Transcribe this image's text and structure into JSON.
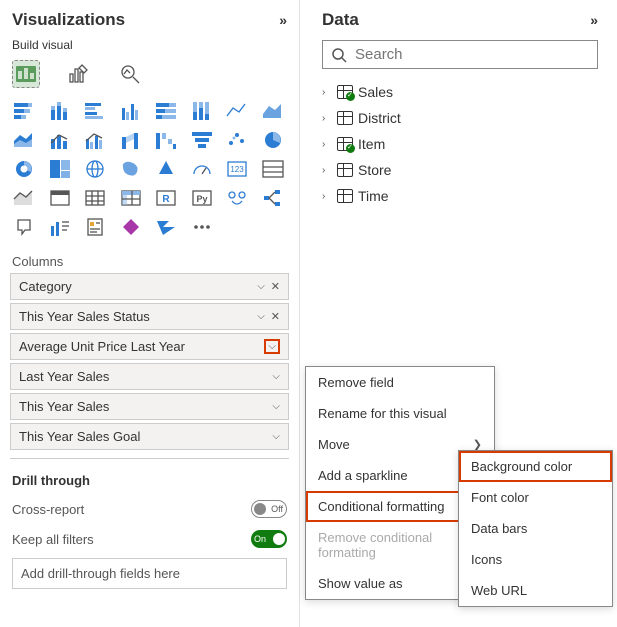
{
  "viz": {
    "title": "Visualizations",
    "subheader": "Build visual",
    "sections": {
      "columns": "Columns",
      "drill": "Drill through"
    },
    "fields": [
      {
        "label": "Category",
        "show_x": true
      },
      {
        "label": "This Year Sales Status",
        "show_x": true
      },
      {
        "label": "Average Unit Price Last Year",
        "show_x": false,
        "chev_highlight": true
      },
      {
        "label": "Last Year Sales",
        "show_x": false
      },
      {
        "label": "This Year Sales",
        "show_x": false
      },
      {
        "label": "This Year Sales Goal",
        "show_x": false
      }
    ],
    "drill": {
      "cross_label": "Cross-report",
      "cross_lbl": "Off",
      "keep_label": "Keep all filters",
      "keep_lbl": "On",
      "placeholder": "Add drill-through fields here"
    }
  },
  "data": {
    "title": "Data",
    "search_placeholder": "Search",
    "tables": [
      {
        "name": "Sales",
        "checked": true
      },
      {
        "name": "District",
        "checked": false
      },
      {
        "name": "Item",
        "checked": true
      },
      {
        "name": "Store",
        "checked": false
      },
      {
        "name": "Time",
        "checked": false
      }
    ]
  },
  "menu1": {
    "items": [
      {
        "label": "Remove field"
      },
      {
        "label": "Rename for this visual"
      },
      {
        "label": "Move",
        "arrow": true
      },
      {
        "label": "Add a sparkline"
      },
      {
        "label": "Conditional formatting",
        "arrow": true,
        "highlighted": true
      },
      {
        "label": "Remove conditional formatting",
        "disabled": true
      },
      {
        "label": "Show value as",
        "arrow": true
      }
    ]
  },
  "menu2": {
    "items": [
      {
        "label": "Background color",
        "highlighted": true
      },
      {
        "label": "Font color"
      },
      {
        "label": "Data bars"
      },
      {
        "label": "Icons"
      },
      {
        "label": "Web URL"
      }
    ]
  }
}
